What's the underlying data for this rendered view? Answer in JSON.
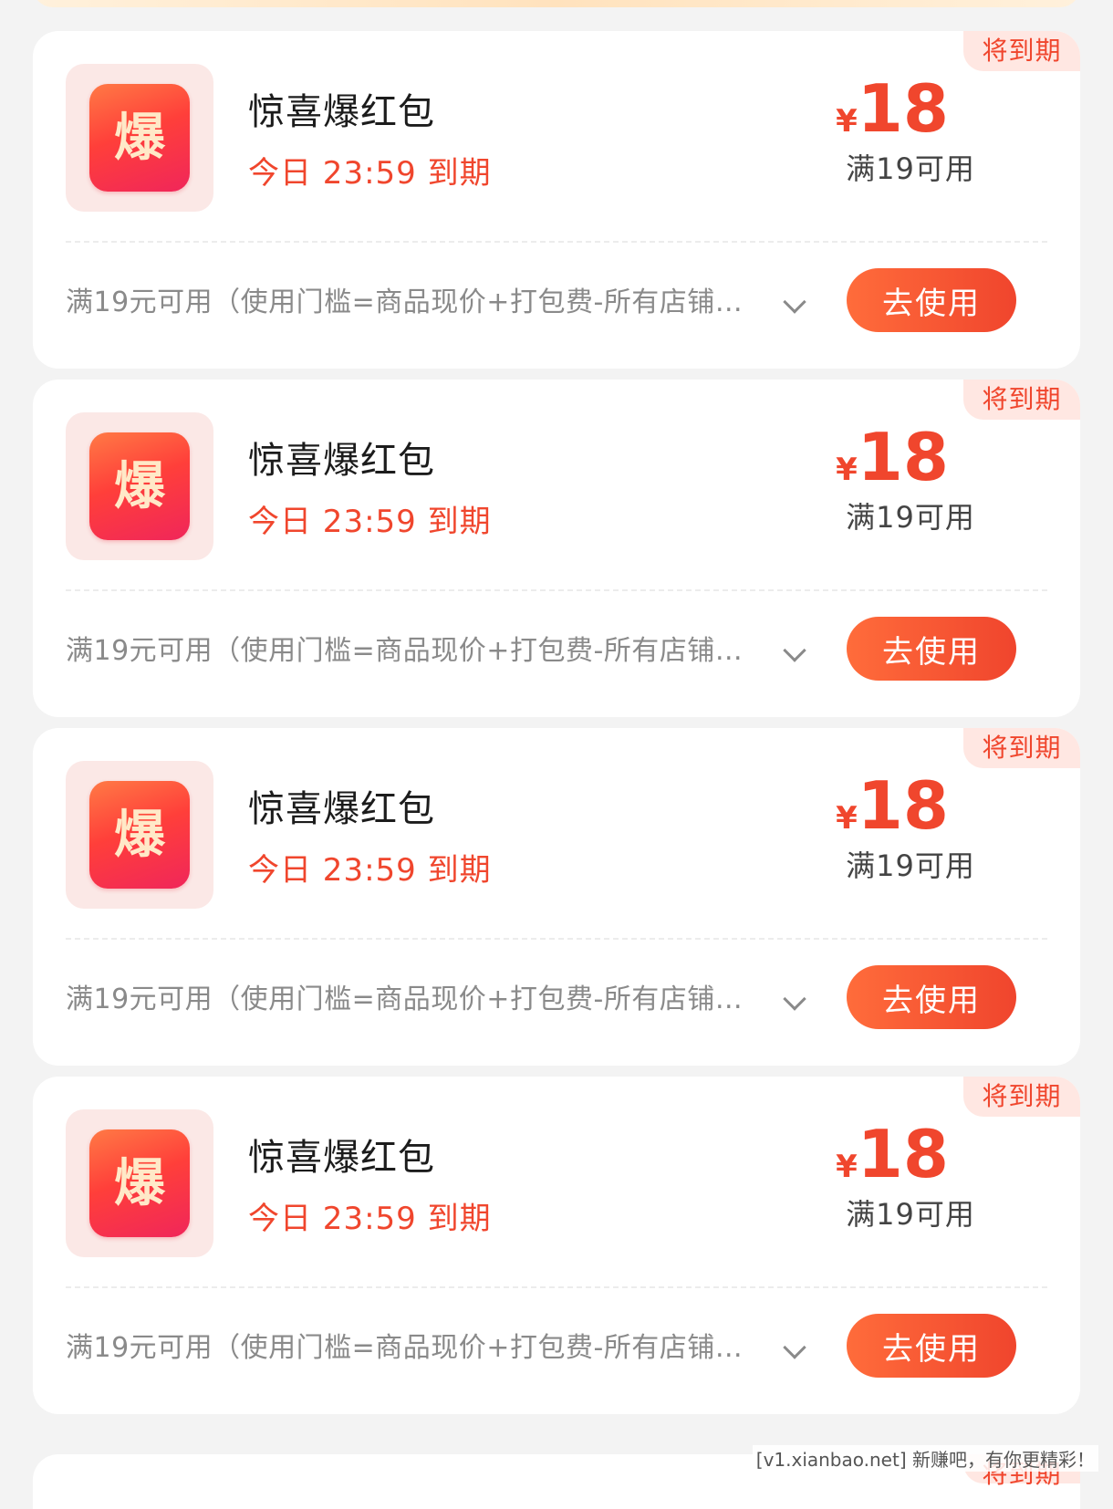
{
  "coupons": [
    {
      "badge": "将到期",
      "icon_label": "爆",
      "title": "惊喜爆红包",
      "expire": "今日 23:59 到期",
      "currency": "¥",
      "amount": "18",
      "threshold": "满19可用",
      "description": "满19元可用（使用门槛=商品现价+打包费-所有店铺…",
      "button_label": "去使用"
    },
    {
      "badge": "将到期",
      "icon_label": "爆",
      "title": "惊喜爆红包",
      "expire": "今日 23:59 到期",
      "currency": "¥",
      "amount": "18",
      "threshold": "满19可用",
      "description": "满19元可用（使用门槛=商品现价+打包费-所有店铺…",
      "button_label": "去使用"
    },
    {
      "badge": "将到期",
      "icon_label": "爆",
      "title": "惊喜爆红包",
      "expire": "今日 23:59 到期",
      "currency": "¥",
      "amount": "18",
      "threshold": "满19可用",
      "description": "满19元可用（使用门槛=商品现价+打包费-所有店铺…",
      "button_label": "去使用"
    },
    {
      "badge": "将到期",
      "icon_label": "爆",
      "title": "惊喜爆红包",
      "expire": "今日 23:59 到期",
      "currency": "¥",
      "amount": "18",
      "threshold": "满19可用",
      "description": "满19元可用（使用门槛=商品现价+打包费-所有店铺…",
      "button_label": "去使用"
    }
  ],
  "next_card": {
    "badge": "将到期"
  },
  "watermark": "[v1.xianbao.net] 新赚吧，有你更精彩！",
  "colors": {
    "accent": "#f0462d",
    "background": "#f3f3f3",
    "card": "#ffffff"
  }
}
